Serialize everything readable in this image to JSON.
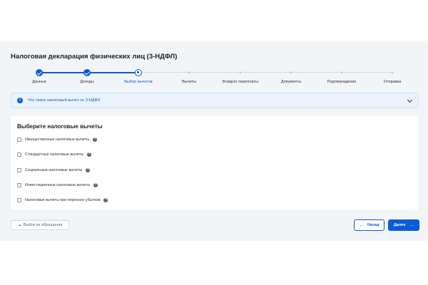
{
  "title": "Налоговая декларация физических лиц (3-НДФЛ)",
  "stepper": {
    "steps": [
      {
        "label": "Данные",
        "state": "done"
      },
      {
        "label": "Доходы",
        "state": "done"
      },
      {
        "label": "Выбор вычетов",
        "state": "current"
      },
      {
        "label": "Вычеты",
        "state": "todo"
      },
      {
        "label": "Возврат переплаты",
        "state": "todo"
      },
      {
        "label": "Документы",
        "state": "todo"
      },
      {
        "label": "Подтверждение",
        "state": "todo"
      },
      {
        "label": "Отправка",
        "state": "todo"
      }
    ]
  },
  "info": {
    "icon": "info-icon",
    "text": "Что такое налоговый вычет по 3-НДФЛ",
    "icon_glyph": "i"
  },
  "deductions": {
    "title": "Выберите налоговые вычеты",
    "options": [
      {
        "label": "Имущественные налоговые вычеты",
        "checked": false,
        "help": "?"
      },
      {
        "label": "Стандартные налоговые вычеты",
        "checked": false,
        "help": "?"
      },
      {
        "label": "Социальные налоговые вычеты",
        "checked": false,
        "help": "?"
      },
      {
        "label": "Инвестиционные налоговые вычеты",
        "checked": false,
        "help": "?"
      },
      {
        "label": "Налоговые вычеты при переносе убытков",
        "checked": false,
        "help": "?"
      }
    ]
  },
  "footer": {
    "exit_label": "Выйти из обращения",
    "back_label": "Назад",
    "next_label": "Далее"
  },
  "colors": {
    "accent": "#0a5bd8",
    "info_bg": "#e9f2fd",
    "page_bg": "#f2f5f8"
  }
}
